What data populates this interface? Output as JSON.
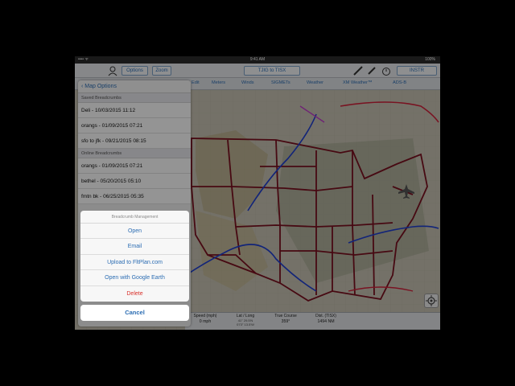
{
  "status": {
    "time": "9:41 AM",
    "battery": "100%",
    "carrier": "•••• ᯤ"
  },
  "toolbar": {
    "options": "Options",
    "zoom": "Zoom",
    "route": "TJIG to TISX",
    "instr": "INSTR"
  },
  "layers": [
    "Edit",
    "Meters",
    "Winds",
    "SIGMETs",
    "Weather",
    "XM Weather™",
    "ADS-B"
  ],
  "map_options": {
    "back_label": "Map Options",
    "saved_section": "Saved Breadcrumbs",
    "saved": [
      "Deli - 10/03/2015 11:12",
      "orangs - 01/09/2015 07:21",
      "sfo to jfk - 09/21/2015 08:15"
    ],
    "online_section": "Online Breadcrumbs",
    "online": [
      "orangs - 01/09/2015 07:21",
      "bethel - 05/20/2015 05:10",
      "fmtn bk - 06/25/2015 05:35"
    ]
  },
  "sheet": {
    "title": "Breadcrumb Management",
    "actions": [
      "Open",
      "Email",
      "Upload to FltPlan.com",
      "Open with Google Earth"
    ],
    "delete": "Delete",
    "cancel": "Cancel"
  },
  "info": {
    "speed_label": "Speed (mph)",
    "speed_value": "0 mph",
    "latlong_label": "Lat / Long",
    "lat_value": "41° 29.5'N",
    "long_value": "073° 13.5'W",
    "course_label": "True Course",
    "course_value": "359°",
    "dist_label": "Dist. (TISX)",
    "dist_value": "1494 NM"
  },
  "colors": {
    "accent": "#2c6db3",
    "delete": "#d9302a",
    "borders": "#7a1020",
    "cold_front": "#1f3fd0",
    "warm_front": "#d0203a"
  }
}
